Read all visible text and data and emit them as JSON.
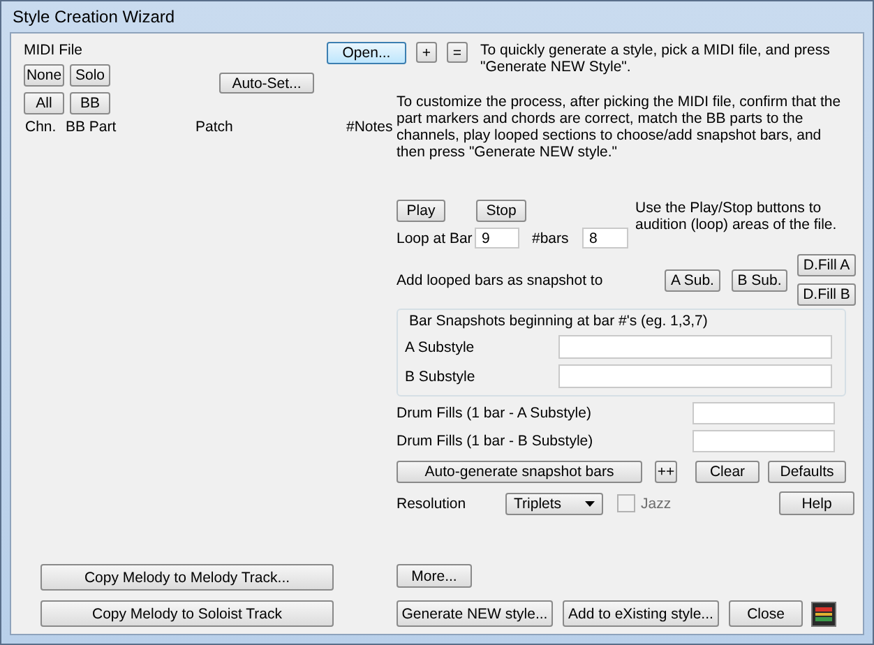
{
  "window": {
    "title": "Style Creation Wizard"
  },
  "midi_panel": {
    "label": "MIDI File",
    "buttons_row_1": [
      "None",
      "Solo"
    ],
    "buttons_row_2": [
      "All",
      "BB"
    ],
    "auto_set_button": "Auto-Set...",
    "columns": [
      "Chn.",
      "BB Part",
      "Patch",
      "#Notes"
    ]
  },
  "copy_buttons": [
    "Copy Melody to Melody Track...",
    "Copy Melody to Soloist Track"
  ],
  "open_row": {
    "open_button": "Open...",
    "small_buttons": [
      "+",
      "="
    ],
    "hint": "To quickly generate a style, pick a MIDI file, and press \"Generate NEW Style\"."
  },
  "customize_hint": "To customize the process, after picking the MIDI file, confirm that the part markers and chords are correct, match the BB parts to the channels, play looped sections to choose/add snapshot bars, and then press \"Generate NEW style.\"",
  "playback": {
    "buttons": [
      "Play",
      "Stop"
    ],
    "hint": "Use the Play/Stop buttons to audition (loop) areas of the file.",
    "loop_label": "Loop at Bar",
    "loop_value": "9",
    "bars_label": "#bars",
    "bars_value": "8"
  },
  "snapshot_add": {
    "label": "Add  looped bars as snapshot to",
    "buttons": [
      "A Sub.",
      "B Sub."
    ],
    "fill_buttons": [
      "D.Fill A",
      "D.Fill B"
    ]
  },
  "bar_snapshots": {
    "title": "Bar Snapshots beginning at bar #'s (eg. 1,3,7)",
    "rows": [
      {
        "label": "A Substyle",
        "value": ""
      },
      {
        "label": "B Substyle",
        "value": ""
      }
    ]
  },
  "drum_fills": [
    {
      "label": "Drum Fills (1 bar - A Substyle)"
    },
    {
      "label": "Drum Fills (1 bar - B Substyle)"
    }
  ],
  "auto_row": {
    "buttons": [
      "Auto-generate snapshot bars",
      "++",
      "Clear",
      "Defaults"
    ]
  },
  "resolution": {
    "label": "Resolution",
    "value": "Triplets",
    "jazz": {
      "label": "Jazz",
      "checked": false,
      "disabled": true
    },
    "help_button": "Help"
  },
  "more_button": "More...",
  "bottom_buttons": [
    "Generate NEW style...",
    "Add to eXisting style...",
    "Close"
  ]
}
